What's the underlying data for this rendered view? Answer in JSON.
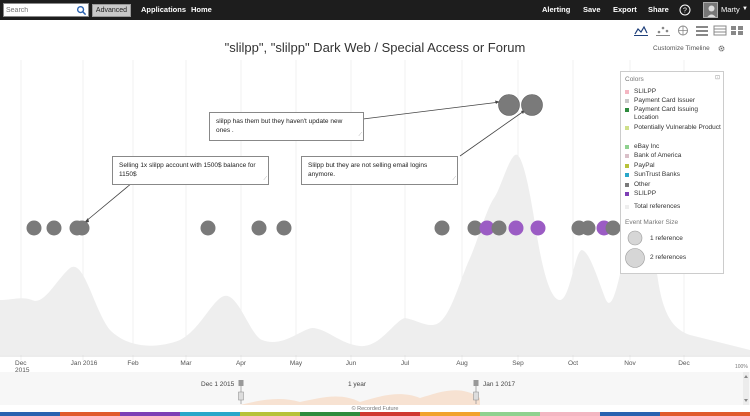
{
  "topbar": {
    "search_placeholder": "Search",
    "advanced_label": "Advanced",
    "applications_label": "Applications",
    "home_label": "Home",
    "alerting_label": "Alerting",
    "save_label": "Save",
    "export_label": "Export",
    "share_label": "Share",
    "user_name": "Marty"
  },
  "header": {
    "title": "\"slilpp\", \"slilpp\" Dark Web / Special Access or Forum",
    "customize_label": "Customize Timeline"
  },
  "view_icons": [
    "timeline-view-icon",
    "scatter-view-icon",
    "map-view-icon",
    "list-view-icon",
    "table-view-icon",
    "grid-view-icon",
    "columns-view-icon"
  ],
  "callouts": [
    {
      "text": "slilpp has them but they haven't update new ones ."
    },
    {
      "text": "Selling 1x slilpp account with 1500$ balance for 1150$"
    },
    {
      "text": "Slilpp but they are not selling email logins anymore."
    }
  ],
  "legend": {
    "title": "Colors",
    "items": [
      {
        "label": "SLILPP",
        "color": "#f4b6c2"
      },
      {
        "label": "Payment Card Issuer",
        "color": "#c8c8c8"
      },
      {
        "label": "Payment Card Issuing Location",
        "color": "#2e8b3d"
      },
      {
        "label": "Potentially Vulnerable Product",
        "color": "#cfe08a"
      },
      {
        "label": "eBay Inc",
        "color": "#8fd18f"
      },
      {
        "label": "Bank of America",
        "color": "#d9c0c8"
      },
      {
        "label": "PayPal",
        "color": "#b8c23a"
      },
      {
        "label": "SunTrust Banks",
        "color": "#2aa7c9"
      },
      {
        "label": "Other",
        "color": "#7a7a7a"
      },
      {
        "label": "SLILPP",
        "color": "#7e3fb5"
      }
    ],
    "total_refs_label": "Total references",
    "marker_size_title": "Event Marker Size",
    "marker_1_label": "1 reference",
    "marker_2_label": "2 references"
  },
  "timeline": {
    "months": [
      "Dec\n2015",
      "Jan 2016",
      "Feb",
      "Mar",
      "Apr",
      "May",
      "Jun",
      "Jul",
      "Aug",
      "Sep",
      "Oct",
      "Nov",
      "Dec"
    ],
    "range_start": "Dec 1 2015",
    "range_span": "1 year",
    "range_end": "Jan 1 2017",
    "zoom_pct": "100%",
    "footer": "© Recorded Future"
  },
  "events": {
    "gray_color": "#7a7a7a",
    "purple_color": "#9b5cc4"
  }
}
